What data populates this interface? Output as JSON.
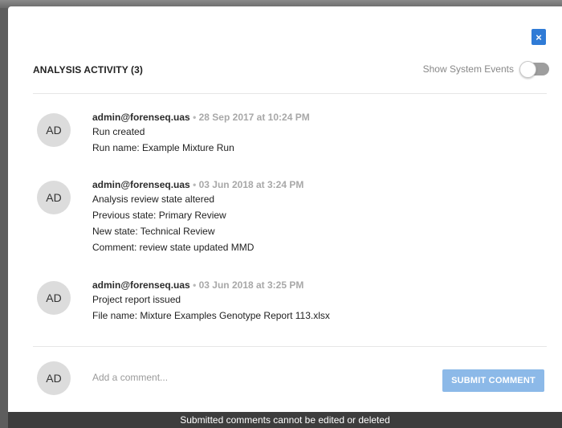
{
  "modal": {
    "close_glyph": "×",
    "title": "ANALYSIS ACTIVITY (3)",
    "toggle_label": "Show System Events",
    "toggle_on": false
  },
  "entries": [
    {
      "avatar": "AD",
      "author": "admin@forenseq.uas",
      "separator": "•",
      "timestamp": "28 Sep 2017 at 10:24 PM",
      "lines": [
        "Run created",
        "Run name: Example Mixture Run"
      ]
    },
    {
      "avatar": "AD",
      "author": "admin@forenseq.uas",
      "separator": "•",
      "timestamp": "03 Jun 2018 at 3:24 PM",
      "lines": [
        "Analysis review state altered",
        "Previous state: Primary Review",
        "New state: Technical Review",
        "Comment: review state updated MMD"
      ]
    },
    {
      "avatar": "AD",
      "author": "admin@forenseq.uas",
      "separator": "•",
      "timestamp": "03 Jun 2018 at 3:25 PM",
      "lines": [
        "Project report issued",
        "File name: Mixture Examples Genotype Report 113.xlsx"
      ]
    }
  ],
  "comment": {
    "avatar": "AD",
    "placeholder": "Add a comment...",
    "value": "",
    "submit_label": "SUBMIT COMMENT"
  },
  "footer": {
    "notice": "Submitted comments cannot be edited or deleted"
  },
  "colors": {
    "accent": "#2f7bd6",
    "submit": "#8cb9e8",
    "footer": "#3d3d3d"
  }
}
